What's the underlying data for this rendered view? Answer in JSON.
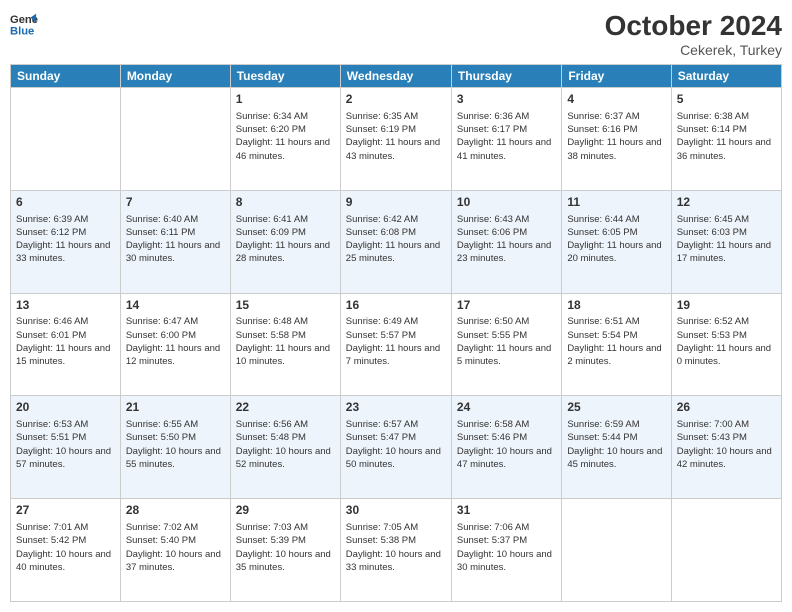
{
  "header": {
    "logo_line1": "General",
    "logo_line2": "Blue",
    "main_title": "October 2024",
    "sub_title": "Cekerek, Turkey"
  },
  "days_of_week": [
    "Sunday",
    "Monday",
    "Tuesday",
    "Wednesday",
    "Thursday",
    "Friday",
    "Saturday"
  ],
  "weeks": [
    [
      {
        "date": "",
        "sunrise": "",
        "sunset": "",
        "daylight": ""
      },
      {
        "date": "",
        "sunrise": "",
        "sunset": "",
        "daylight": ""
      },
      {
        "date": "1",
        "sunrise": "Sunrise: 6:34 AM",
        "sunset": "Sunset: 6:20 PM",
        "daylight": "Daylight: 11 hours and 46 minutes."
      },
      {
        "date": "2",
        "sunrise": "Sunrise: 6:35 AM",
        "sunset": "Sunset: 6:19 PM",
        "daylight": "Daylight: 11 hours and 43 minutes."
      },
      {
        "date": "3",
        "sunrise": "Sunrise: 6:36 AM",
        "sunset": "Sunset: 6:17 PM",
        "daylight": "Daylight: 11 hours and 41 minutes."
      },
      {
        "date": "4",
        "sunrise": "Sunrise: 6:37 AM",
        "sunset": "Sunset: 6:16 PM",
        "daylight": "Daylight: 11 hours and 38 minutes."
      },
      {
        "date": "5",
        "sunrise": "Sunrise: 6:38 AM",
        "sunset": "Sunset: 6:14 PM",
        "daylight": "Daylight: 11 hours and 36 minutes."
      }
    ],
    [
      {
        "date": "6",
        "sunrise": "Sunrise: 6:39 AM",
        "sunset": "Sunset: 6:12 PM",
        "daylight": "Daylight: 11 hours and 33 minutes."
      },
      {
        "date": "7",
        "sunrise": "Sunrise: 6:40 AM",
        "sunset": "Sunset: 6:11 PM",
        "daylight": "Daylight: 11 hours and 30 minutes."
      },
      {
        "date": "8",
        "sunrise": "Sunrise: 6:41 AM",
        "sunset": "Sunset: 6:09 PM",
        "daylight": "Daylight: 11 hours and 28 minutes."
      },
      {
        "date": "9",
        "sunrise": "Sunrise: 6:42 AM",
        "sunset": "Sunset: 6:08 PM",
        "daylight": "Daylight: 11 hours and 25 minutes."
      },
      {
        "date": "10",
        "sunrise": "Sunrise: 6:43 AM",
        "sunset": "Sunset: 6:06 PM",
        "daylight": "Daylight: 11 hours and 23 minutes."
      },
      {
        "date": "11",
        "sunrise": "Sunrise: 6:44 AM",
        "sunset": "Sunset: 6:05 PM",
        "daylight": "Daylight: 11 hours and 20 minutes."
      },
      {
        "date": "12",
        "sunrise": "Sunrise: 6:45 AM",
        "sunset": "Sunset: 6:03 PM",
        "daylight": "Daylight: 11 hours and 17 minutes."
      }
    ],
    [
      {
        "date": "13",
        "sunrise": "Sunrise: 6:46 AM",
        "sunset": "Sunset: 6:01 PM",
        "daylight": "Daylight: 11 hours and 15 minutes."
      },
      {
        "date": "14",
        "sunrise": "Sunrise: 6:47 AM",
        "sunset": "Sunset: 6:00 PM",
        "daylight": "Daylight: 11 hours and 12 minutes."
      },
      {
        "date": "15",
        "sunrise": "Sunrise: 6:48 AM",
        "sunset": "Sunset: 5:58 PM",
        "daylight": "Daylight: 11 hours and 10 minutes."
      },
      {
        "date": "16",
        "sunrise": "Sunrise: 6:49 AM",
        "sunset": "Sunset: 5:57 PM",
        "daylight": "Daylight: 11 hours and 7 minutes."
      },
      {
        "date": "17",
        "sunrise": "Sunrise: 6:50 AM",
        "sunset": "Sunset: 5:55 PM",
        "daylight": "Daylight: 11 hours and 5 minutes."
      },
      {
        "date": "18",
        "sunrise": "Sunrise: 6:51 AM",
        "sunset": "Sunset: 5:54 PM",
        "daylight": "Daylight: 11 hours and 2 minutes."
      },
      {
        "date": "19",
        "sunrise": "Sunrise: 6:52 AM",
        "sunset": "Sunset: 5:53 PM",
        "daylight": "Daylight: 11 hours and 0 minutes."
      }
    ],
    [
      {
        "date": "20",
        "sunrise": "Sunrise: 6:53 AM",
        "sunset": "Sunset: 5:51 PM",
        "daylight": "Daylight: 10 hours and 57 minutes."
      },
      {
        "date": "21",
        "sunrise": "Sunrise: 6:55 AM",
        "sunset": "Sunset: 5:50 PM",
        "daylight": "Daylight: 10 hours and 55 minutes."
      },
      {
        "date": "22",
        "sunrise": "Sunrise: 6:56 AM",
        "sunset": "Sunset: 5:48 PM",
        "daylight": "Daylight: 10 hours and 52 minutes."
      },
      {
        "date": "23",
        "sunrise": "Sunrise: 6:57 AM",
        "sunset": "Sunset: 5:47 PM",
        "daylight": "Daylight: 10 hours and 50 minutes."
      },
      {
        "date": "24",
        "sunrise": "Sunrise: 6:58 AM",
        "sunset": "Sunset: 5:46 PM",
        "daylight": "Daylight: 10 hours and 47 minutes."
      },
      {
        "date": "25",
        "sunrise": "Sunrise: 6:59 AM",
        "sunset": "Sunset: 5:44 PM",
        "daylight": "Daylight: 10 hours and 45 minutes."
      },
      {
        "date": "26",
        "sunrise": "Sunrise: 7:00 AM",
        "sunset": "Sunset: 5:43 PM",
        "daylight": "Daylight: 10 hours and 42 minutes."
      }
    ],
    [
      {
        "date": "27",
        "sunrise": "Sunrise: 7:01 AM",
        "sunset": "Sunset: 5:42 PM",
        "daylight": "Daylight: 10 hours and 40 minutes."
      },
      {
        "date": "28",
        "sunrise": "Sunrise: 7:02 AM",
        "sunset": "Sunset: 5:40 PM",
        "daylight": "Daylight: 10 hours and 37 minutes."
      },
      {
        "date": "29",
        "sunrise": "Sunrise: 7:03 AM",
        "sunset": "Sunset: 5:39 PM",
        "daylight": "Daylight: 10 hours and 35 minutes."
      },
      {
        "date": "30",
        "sunrise": "Sunrise: 7:05 AM",
        "sunset": "Sunset: 5:38 PM",
        "daylight": "Daylight: 10 hours and 33 minutes."
      },
      {
        "date": "31",
        "sunrise": "Sunrise: 7:06 AM",
        "sunset": "Sunset: 5:37 PM",
        "daylight": "Daylight: 10 hours and 30 minutes."
      },
      {
        "date": "",
        "sunrise": "",
        "sunset": "",
        "daylight": ""
      },
      {
        "date": "",
        "sunrise": "",
        "sunset": "",
        "daylight": ""
      }
    ]
  ]
}
